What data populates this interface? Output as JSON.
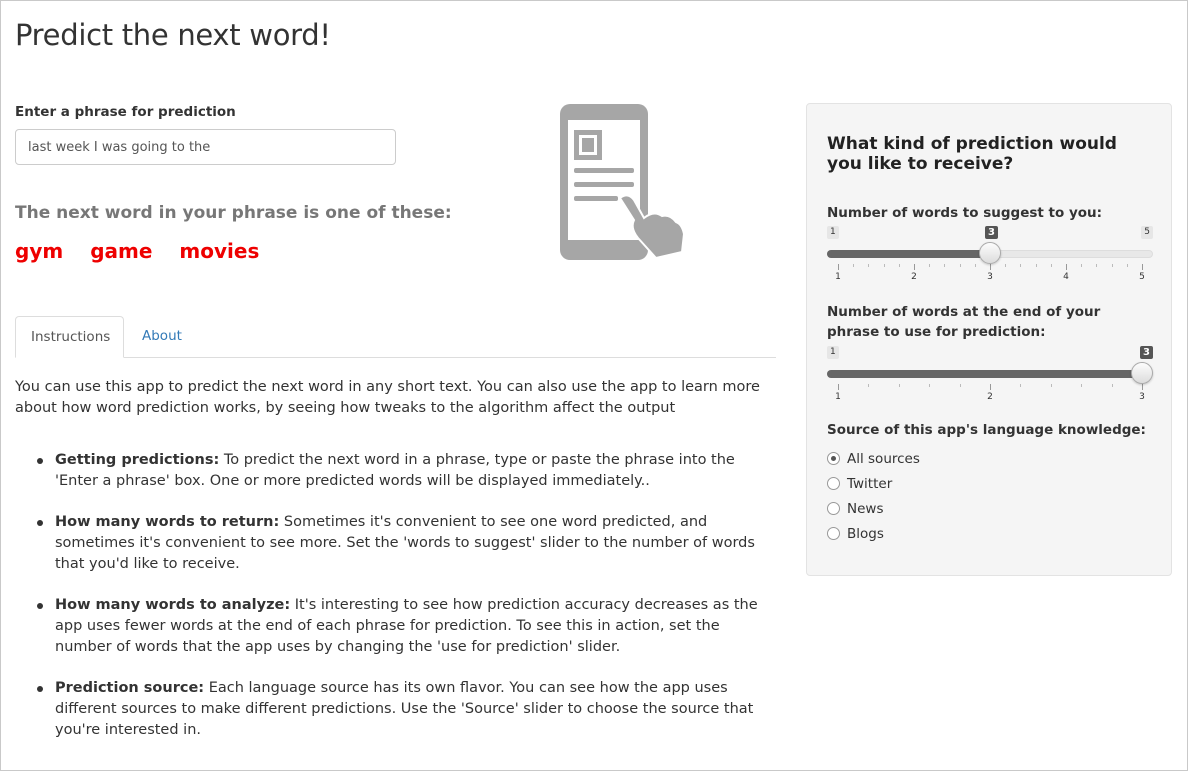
{
  "app": {
    "title": "Predict the next word!"
  },
  "phrase": {
    "label": "Enter a phrase for prediction",
    "value": "last week I was going to the"
  },
  "results": {
    "heading": "The next word in your phrase is one of these:",
    "words": [
      "gym",
      "game",
      "movies"
    ],
    "color": "#ee0000"
  },
  "illustration": {
    "icon": "phone-touch-icon"
  },
  "tabs": [
    {
      "label": "Instructions",
      "active": true
    },
    {
      "label": "About",
      "active": false
    }
  ],
  "instructions": {
    "intro": "You can use this app to predict the next word in any short text. You can also use the app to learn more about how word prediction works, by seeing how tweaks to the algorithm affect the output",
    "items": [
      {
        "title": "Getting predictions:",
        "text": " To predict the next word in a phrase, type or paste the phrase into the 'Enter a phrase' box. One or more predicted words will be displayed immediately.."
      },
      {
        "title": "How many words to return:",
        "text": " Sometimes it's convenient to see one word predicted, and sometimes it's convenient to see more. Set the 'words to suggest' slider to the number of words that you'd like to receive."
      },
      {
        "title": "How many words to analyze:",
        "text": " It's interesting to see how prediction accuracy decreases as the app uses fewer words at the end of each phrase for prediction. To see this in action, set the number of words that the app uses by changing the 'use for prediction' slider."
      },
      {
        "title": "Prediction source:",
        "text": " Each language source has its own flavor. You can see how the app uses different sources to make different predictions. Use the 'Source' slider to choose the source that you're interested in."
      }
    ]
  },
  "panel": {
    "title": "What kind of prediction would you like to receive?",
    "slider1": {
      "label": "Number of words to suggest to you:",
      "min": 1,
      "max": 5,
      "value": 3,
      "ticks": [
        1,
        2,
        3,
        4,
        5
      ]
    },
    "slider2": {
      "label": "Number of words at the end of your phrase to use for prediction:",
      "min": 1,
      "max": 3,
      "value": 3,
      "ticks": [
        1,
        2,
        3
      ]
    },
    "source": {
      "label": "Source of this app's language knowledge:",
      "options": [
        "All sources",
        "Twitter",
        "News",
        "Blogs"
      ],
      "selected": "All sources"
    }
  }
}
